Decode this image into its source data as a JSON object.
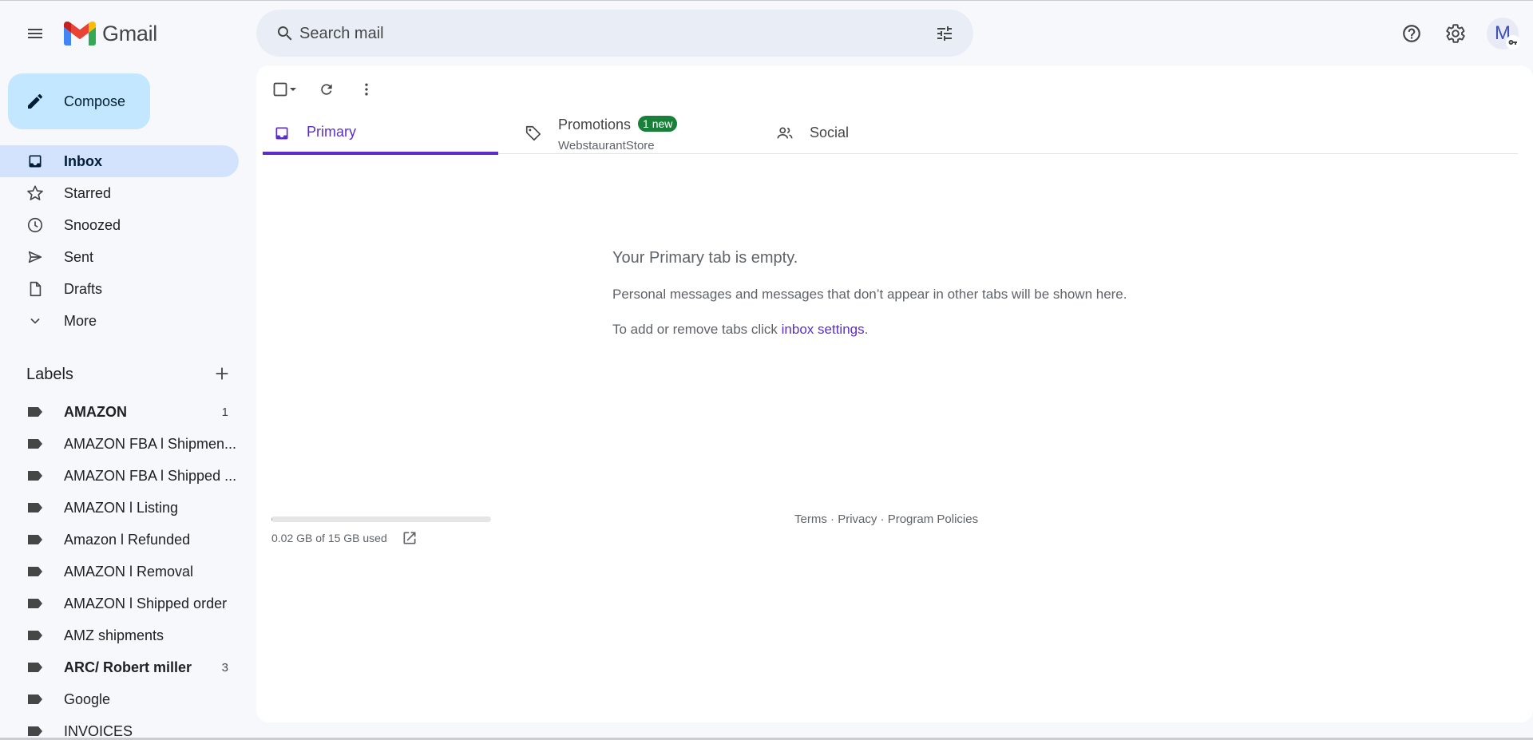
{
  "app": {
    "name": "Gmail"
  },
  "search": {
    "placeholder": "Search mail"
  },
  "header": {
    "avatar_letter": "M"
  },
  "compose": {
    "label": "Compose"
  },
  "nav": [
    {
      "id": "inbox",
      "label": "Inbox",
      "icon": "inbox-icon",
      "active": true
    },
    {
      "id": "starred",
      "label": "Starred",
      "icon": "star-icon"
    },
    {
      "id": "snoozed",
      "label": "Snoozed",
      "icon": "clock-icon"
    },
    {
      "id": "sent",
      "label": "Sent",
      "icon": "send-icon"
    },
    {
      "id": "drafts",
      "label": "Drafts",
      "icon": "draft-icon"
    },
    {
      "id": "more",
      "label": "More",
      "icon": "chevron-down-icon"
    }
  ],
  "labels": {
    "title": "Labels",
    "items": [
      {
        "label": "AMAZON",
        "count": "1",
        "bold": true
      },
      {
        "label": "AMAZON FBA l Shipmen...",
        "count": ""
      },
      {
        "label": "AMAZON FBA l Shipped ...",
        "count": ""
      },
      {
        "label": "AMAZON l Listing",
        "count": ""
      },
      {
        "label": "Amazon l Refunded",
        "count": ""
      },
      {
        "label": "AMAZON l Removal",
        "count": ""
      },
      {
        "label": "AMAZON l Shipped order",
        "count": ""
      },
      {
        "label": "AMZ shipments",
        "count": ""
      },
      {
        "label": "ARC/ Robert miller",
        "count": "3",
        "bold": true
      },
      {
        "label": "Google",
        "count": ""
      },
      {
        "label": "INVOICES",
        "count": ""
      }
    ]
  },
  "tabs": {
    "primary": {
      "label": "Primary"
    },
    "promotions": {
      "label": "Promotions",
      "badge": "1 new",
      "subtitle": "WebstaurantStore"
    },
    "social": {
      "label": "Social"
    }
  },
  "empty_state": {
    "title": "Your Primary tab is empty.",
    "line1": "Personal messages and messages that don’t appear in other tabs will be shown here.",
    "line2_prefix": "To add or remove tabs click ",
    "line2_link": "inbox settings",
    "line2_suffix": "."
  },
  "storage": {
    "text": "0.02 GB of 15 GB used",
    "used_fraction": 0.0013
  },
  "footer": {
    "terms": "Terms",
    "privacy": "Privacy",
    "policies": "Program Policies",
    "separator": " · "
  },
  "colors": {
    "accent": "#5b2ec9",
    "compose_bg": "#c2e7ff",
    "active_nav": "#d3e3fd",
    "badge": "#188038"
  }
}
